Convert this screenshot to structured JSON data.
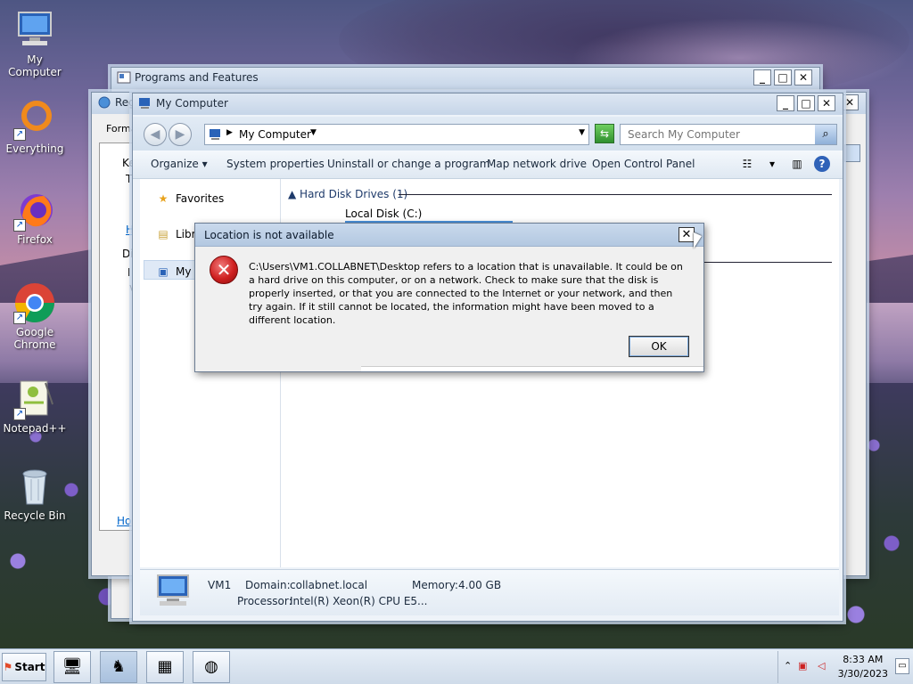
{
  "desktop": {
    "icons": [
      {
        "label": "My Computer",
        "icon": "computer-icon"
      },
      {
        "label": "Everything",
        "icon": "everything-icon"
      },
      {
        "label": "Firefox",
        "icon": "firefox-icon"
      },
      {
        "label": "Google Chrome",
        "icon": "chrome-icon"
      },
      {
        "label": "Notepad++",
        "icon": "notepadpp-icon"
      },
      {
        "label": "Recycle Bin",
        "icon": "recycle-bin-icon"
      }
    ]
  },
  "programs_window": {
    "title": "Programs and Features"
  },
  "region_window": {
    "title": "Reg",
    "tab": "Forma",
    "ke": "Ke",
    "t": "T",
    "h": "H",
    "di": "Di",
    "i": "I",
    "v": "v",
    "how": "Ho"
  },
  "mycomputer": {
    "title": "My Computer",
    "address": "My Computer",
    "search_placeholder": "Search My Computer",
    "commands": [
      "Organize",
      "System properties",
      "Uninstall or change a program",
      "Map network drive",
      "Open Control Panel"
    ],
    "nav": {
      "favorites": "Favorites",
      "libraries": "Libra",
      "mycomputer": "My C"
    },
    "group": {
      "name": "Hard Disk Drives (1)"
    },
    "drive": "Local Disk (C:)",
    "details": {
      "name": "VM1",
      "domain_label": "Domain:",
      "domain": "collabnet.local",
      "memory_label": "Memory:",
      "memory": "4.00 GB",
      "processor_label": "Processor:",
      "processor": "Intel(R) Xeon(R) CPU E5..."
    }
  },
  "dialog": {
    "title": "Location is not available",
    "message": "C:\\Users\\VM1.COLLABNET\\Desktop refers to a location that is unavailable. It could be on a hard drive on this computer, or on a network. Check to make sure that the disk is properly inserted, or that you are connected to the Internet or your network, and then try again. If it still cannot be located, the information might have been moved to a different location.",
    "ok_label": "OK",
    "close_glyph": "✕"
  },
  "taskbar": {
    "start_label": "Start",
    "time": "8:33 AM",
    "date": "3/30/2023"
  }
}
